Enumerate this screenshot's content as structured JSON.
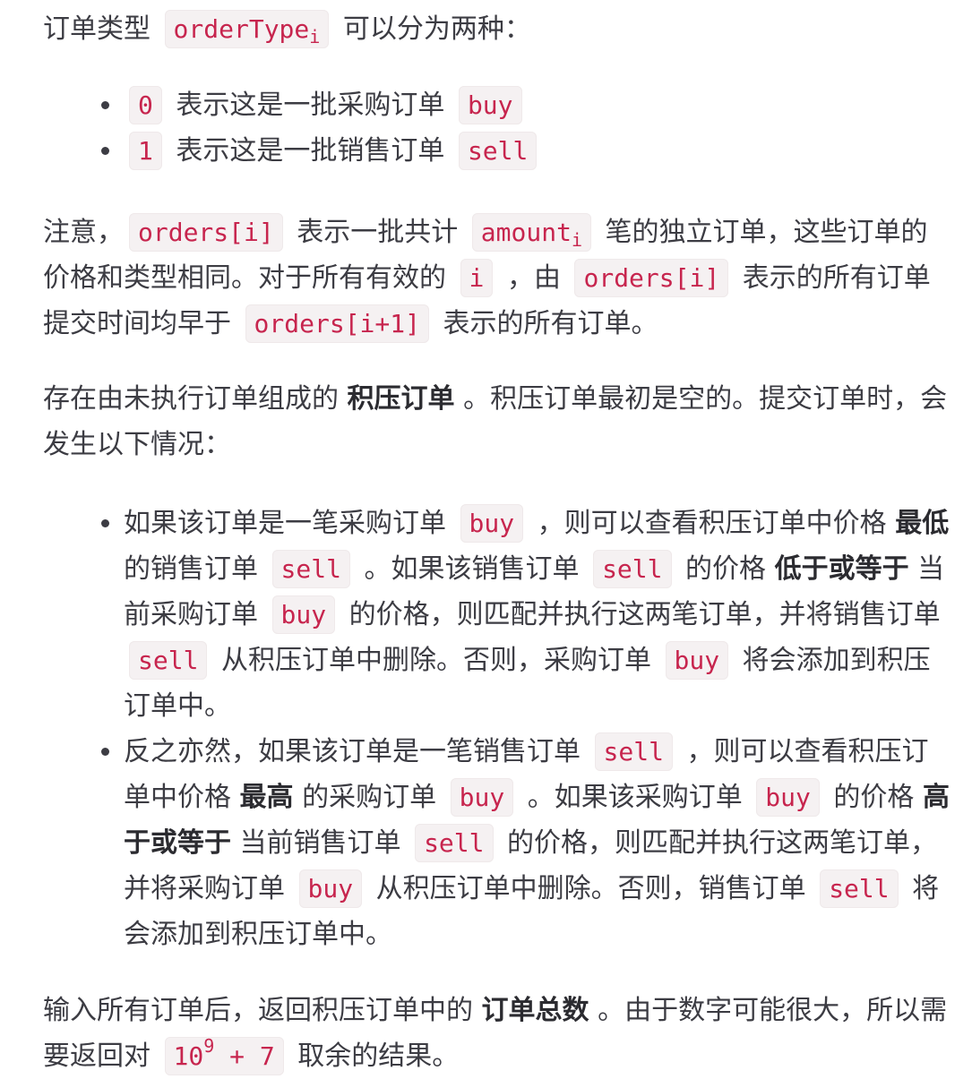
{
  "p1": {
    "t1": "订单类型 ",
    "code_base": "orderType",
    "code_sub": "i",
    "t2": " 可以分为两种："
  },
  "list1": [
    {
      "code": "0",
      "text": " 表示这是一批采购订单 ",
      "code2": "buy"
    },
    {
      "code": "1",
      "text": " 表示这是一批销售订单 ",
      "code2": "sell"
    }
  ],
  "p2": {
    "t1": "注意，",
    "c1": "orders[i]",
    "t2": " 表示一批共计 ",
    "c2_base": "amount",
    "c2_sub": "i",
    "t3": " 笔的独立订单，这些订单的价格和类型相同。对于所有有效的 ",
    "c3": "i",
    "t4": " ，由 ",
    "c4": "orders[i]",
    "t5": " 表示的所有订单提交时间均早于 ",
    "c5": "orders[i+1]",
    "t6": " 表示的所有订单。"
  },
  "p3": {
    "t1": "存在由未执行订单组成的 ",
    "b1": "积压订单",
    "t2": " 。积压订单最初是空的。提交订单时，会发生以下情况："
  },
  "list2": {
    "item1": {
      "t1": "如果该订单是一笔采购订单 ",
      "c1": "buy",
      "t2": " ，则可以查看积压订单中价格 ",
      "b1": "最低",
      "t3": " 的销售订单 ",
      "c2": "sell",
      "t4": " 。如果该销售订单 ",
      "c3": "sell",
      "t5": " 的价格 ",
      "b2": "低于或等于",
      "t6": " 当前采购订单 ",
      "c4": "buy",
      "t7": " 的价格，则匹配并执行这两笔订单，并将销售订单 ",
      "c5": "sell",
      "t8": " 从积压订单中删除。否则，采购订单 ",
      "c6": "buy",
      "t9": " 将会添加到积压订单中。"
    },
    "item2": {
      "t1": "反之亦然，如果该订单是一笔销售订单 ",
      "c1": "sell",
      "t2": " ，则可以查看积压订单中价格 ",
      "b1": "最高",
      "t3": " 的采购订单 ",
      "c2": "buy",
      "t4": " 。如果该采购订单 ",
      "c3": "buy",
      "t5": " 的价格 ",
      "b2": "高于或等于",
      "t6": " 当前销售订单 ",
      "c4": "sell",
      "t7": " 的价格，则匹配并执行这两笔订单，并将采购订单 ",
      "c5": "buy",
      "t8": " 从积压订单中删除。否则，销售订单 ",
      "c6": "sell",
      "t9": " 将会添加到积压订单中。"
    }
  },
  "p4": {
    "t1": "输入所有订单后，返回积压订单中的 ",
    "b1": "订单总数",
    "t2": " 。由于数字可能很大，所以需要返回对 ",
    "c_base": "10",
    "c_sup": "9",
    "c_rest": " + 7",
    "t3": " 取余的结果。"
  }
}
